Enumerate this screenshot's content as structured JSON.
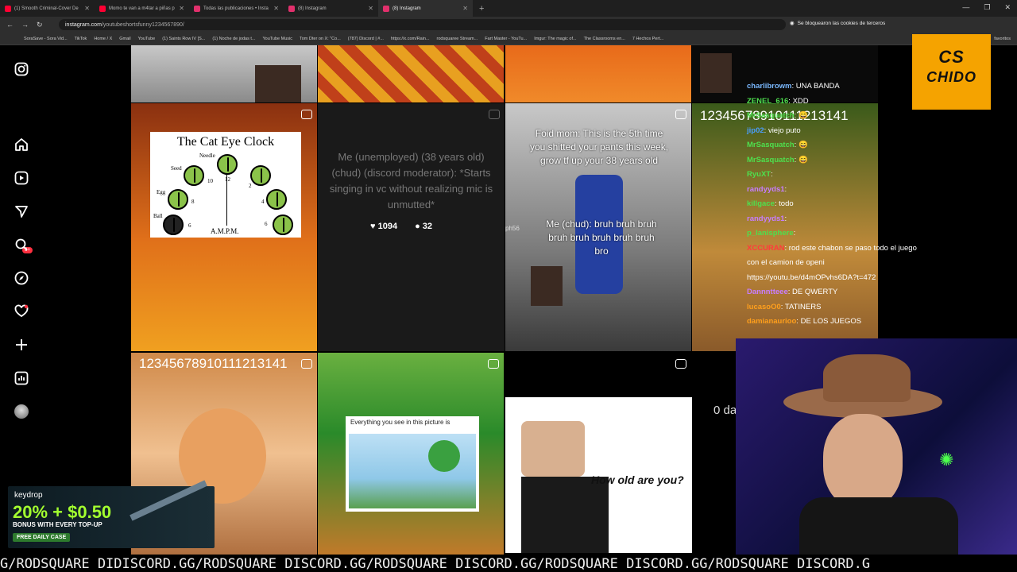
{
  "browser": {
    "tabs": [
      {
        "label": "(1) Smooth Criminal-Cover De",
        "color": "#ff0033",
        "active": false
      },
      {
        "label": "Momo te van a m4tar a piñas p",
        "color": "#ff0033",
        "active": false
      },
      {
        "label": "Todas las publicaciones • Insta",
        "color": "#e1306c",
        "active": false
      },
      {
        "label": "(8) Instagram",
        "color": "#e1306c",
        "active": false
      },
      {
        "label": "(8) Instagram",
        "color": "#e1306c",
        "active": true
      }
    ],
    "url_host": "instagram.com",
    "url_path": "/youtubeshortsfunny1234567890/",
    "cookie_notice": "Se bloquearon las cookies de terceros",
    "bookmarks": [
      "SoraSave - Sora Vid...",
      "TikTok",
      "Home / X",
      "Gmail",
      "YouTube",
      "(1) Saints Row IV [S...",
      "(1) Noche de jodas t...",
      "YouTube Music",
      "Tom Dter on X: \"Co...",
      "(787) Discord | #...",
      "https://x.com/Rain...",
      "rodsquaree Stream...",
      "Fart Master - YouTu...",
      "Imgur: The magic of...",
      "The Classrooms en...",
      "7 Hechos Pert..."
    ],
    "bookmarks_more": "favoritos"
  },
  "sidebar": {
    "notification_badge": "9+"
  },
  "posts": {
    "cat_clock": {
      "title": "The Cat Eye Clock",
      "labels": [
        "Needle",
        "Seed",
        "Egg",
        "Ball",
        "10",
        "12",
        "2",
        "8",
        "4",
        "6",
        "6"
      ],
      "footer": "A.M.P.M."
    },
    "chud": {
      "text": "Me (unemployed) (38 years old) (chud) (discord moderator): *Starts singing in vc without realizing mic is unmutted*",
      "likes": "1094",
      "comments": "32"
    },
    "foid": {
      "top": "Foid mom: This is the 5th time you shitted your pants this week, grow tf up your 38 years old",
      "bottom": "Me (chud): bruh bruh bruh bruh bruh bruh bruh bruh bro",
      "side": "ph56"
    },
    "numbers_top": "12345678910111213141",
    "numbers_bottom": "12345678910111213141",
    "picture": "Everything you see in this picture is",
    "roblox": "How old are you?",
    "partial": "0 da"
  },
  "chat": [
    {
      "user": "charlibrowm",
      "msg": "UNA BANDA",
      "color": "#7ab8ff"
    },
    {
      "user": "ZENEL_616",
      "msg": "XDD",
      "color": "#4ee04e"
    },
    {
      "user": "MrSasquatch",
      "msg": "😄",
      "color": "#4ee04e"
    },
    {
      "user": "jip02",
      "msg": "viejo puto",
      "color": "#4a9eff"
    },
    {
      "user": "MrSasquatch",
      "msg": "😄",
      "color": "#4ee04e"
    },
    {
      "user": "MrSasquatch",
      "msg": "😄",
      "color": "#4ee04e"
    },
    {
      "user": "RyuXT",
      "msg": "",
      "color": "#4ee04e"
    },
    {
      "user": "randyyds1",
      "msg": "",
      "color": "#c77dff"
    },
    {
      "user": "killgace",
      "msg": "todo",
      "color": "#4ee04e"
    },
    {
      "user": "randyyds1",
      "msg": "",
      "color": "#c77dff"
    },
    {
      "user": "p_lanisphere",
      "msg": "",
      "color": "#4ee04e"
    },
    {
      "user": "XCCURAN",
      "msg": "rod este chabon se paso todo el juego con el camion de openi https://youtu.be/d4mOPvhs6DA?t=472",
      "color": "#ff3b3b"
    },
    {
      "user": "Dannntteee",
      "msg": "DE QWERTY",
      "color": "#c77dff"
    },
    {
      "user": "lucasoO0",
      "msg": "TATINERS",
      "color": "#ff9f1c"
    },
    {
      "user": "damianaurioo",
      "msg": "DE LOS JUEGOS",
      "color": "#ff9f1c"
    }
  ],
  "overlay": {
    "chido_top": "CS",
    "chido_bottom": "CHIDO",
    "keydrop_brand": "keydrop",
    "keydrop_offer": "20% + $0.50",
    "keydrop_sub": "BONUS WITH EVERY TOP-UP",
    "keydrop_cta": "FREE DAILY CASE",
    "ticker": "G/RODSQUARE DIDISCORD.GG/RODSQUARE DISCORD.GG/RODSQUARE DISCORD.GG/RODSQUARE DISCORD.GG/RODSQUARE DISCORD.G"
  }
}
